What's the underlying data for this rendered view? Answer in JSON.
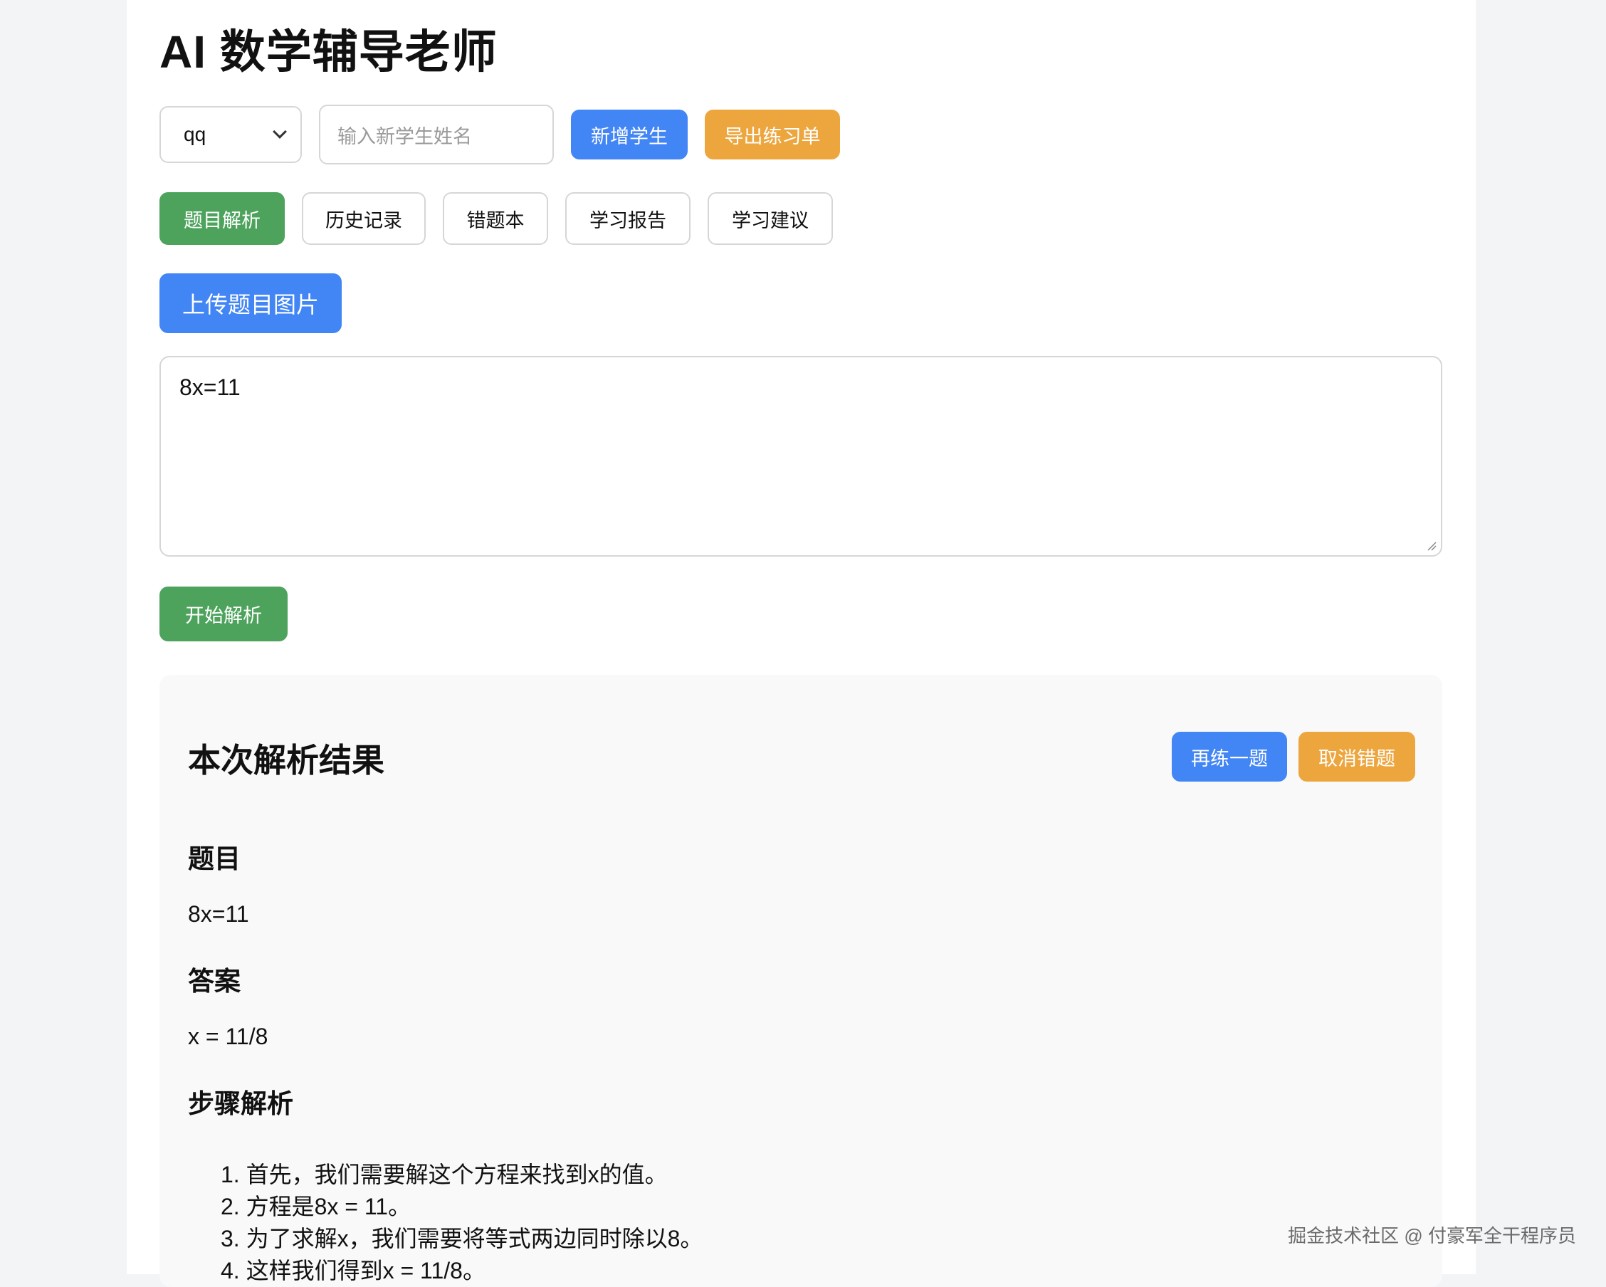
{
  "title": "AI 数学辅导老师",
  "student_select": {
    "value": "qq"
  },
  "new_student": {
    "placeholder": "输入新学生姓名"
  },
  "buttons": {
    "add_student": "新增学生",
    "export": "导出练习单",
    "upload": "上传题目图片",
    "start": "开始解析",
    "again": "再练一题",
    "cancel_wrong": "取消错题"
  },
  "tabs": [
    {
      "label": "题目解析",
      "active": true
    },
    {
      "label": "历史记录",
      "active": false
    },
    {
      "label": "错题本",
      "active": false
    },
    {
      "label": "学习报告",
      "active": false
    },
    {
      "label": "学习建议",
      "active": false
    }
  ],
  "question_input": {
    "value": "8x=11"
  },
  "result": {
    "title": "本次解析结果",
    "question_heading": "题目",
    "question": "8x=11",
    "answer_heading": "答案",
    "answer": "x = 11/8",
    "steps_heading": "步骤解析",
    "steps": [
      "首先，我们需要解这个方程来找到x的值。",
      "方程是8x = 11。",
      "为了求解x，我们需要将等式两边同时除以8。",
      "这样我们得到x = 11/8。"
    ]
  },
  "watermark": "掘金技术社区 @ 付豪军全干程序员",
  "colors": {
    "blue": "#4285f4",
    "orange": "#eda63e",
    "green": "#4da35c"
  }
}
